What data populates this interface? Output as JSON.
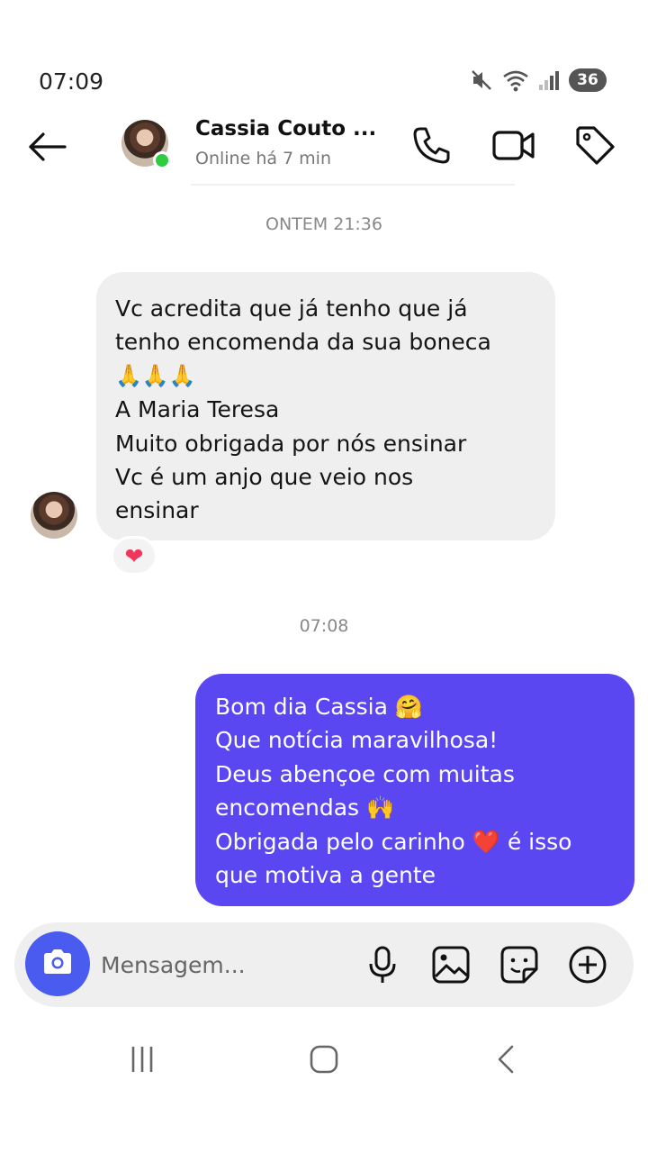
{
  "status_bar": {
    "time": "07:09",
    "battery": "36",
    "icons": [
      "mute-icon",
      "wifi-icon",
      "signal-icon",
      "battery-icon"
    ]
  },
  "header": {
    "contact_name": "Cassia Couto ...",
    "contact_status": "Online há 7 min",
    "icons": [
      "back-arrow-icon",
      "phone-icon",
      "video-camera-icon",
      "tag-icon"
    ],
    "online_color": "#2ecc40"
  },
  "conversation": {
    "timestamp_1": "ONTEM 21:36",
    "incoming_message": {
      "lines": [
        "Vc acredita que já tenho que já",
        "tenho encomenda da sua boneca",
        "🙏🙏🙏",
        "A Maria Teresa",
        "Muito obrigada por nós ensinar",
        "Vc é um anjo que veio nos",
        "ensinar"
      ],
      "reaction": "❤"
    },
    "timestamp_2": "07:08",
    "outgoing_message": {
      "lines": [
        "Bom dia Cassia 🤗",
        "Que notícia maravilhosa!",
        "Deus abençoe com muitas",
        "encomendas 🙌",
        "Obrigada pelo carinho ❤️ é isso",
        "que motiva a gente"
      ]
    }
  },
  "composer": {
    "placeholder": "Mensagem...",
    "icons": [
      "camera-icon",
      "microphone-icon",
      "gallery-icon",
      "sticker-icon",
      "plus-circle-icon"
    ]
  },
  "nav_bar": {
    "icons": [
      "recents-icon",
      "home-icon",
      "back-icon"
    ]
  },
  "colors": {
    "outgoing_bubble": "#5a47f2",
    "incoming_bubble": "#efefef",
    "camera_button": "#4a5cf0",
    "reaction_heart": "#f0365a"
  }
}
